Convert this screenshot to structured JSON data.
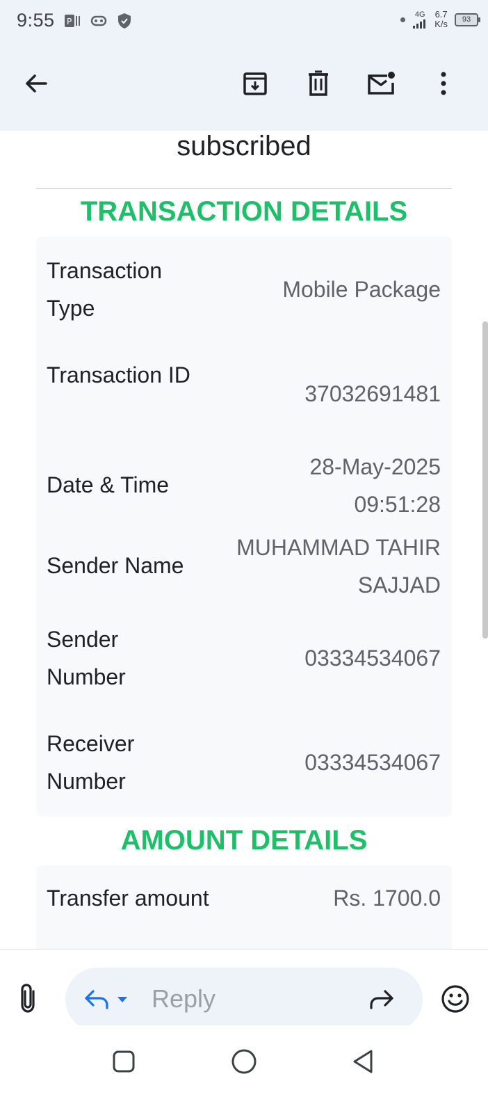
{
  "status": {
    "time": "9:55",
    "network": "4G",
    "speed_top": "6.7",
    "speed_bottom": "K/s",
    "battery": "93"
  },
  "toolbar": {
    "icons": [
      "back-arrow-icon",
      "archive-icon",
      "delete-icon",
      "mark-unread-icon",
      "more-vert-icon"
    ]
  },
  "email": {
    "intro_text": "subscribed",
    "transaction_title": "TRANSACTION DETAILS",
    "transaction_rows": [
      {
        "label": "Transaction Type",
        "value": "Mobile Package"
      },
      {
        "label": "Transaction ID",
        "value": "37032691481"
      },
      {
        "label": "Date & Time",
        "value": "28-May-2025 09:51:28"
      },
      {
        "label": "Sender Name",
        "value": "MUHAMMAD TAHIR SAJJAD"
      },
      {
        "label": "Sender Number",
        "value": "03334534067"
      },
      {
        "label": "Receiver Number",
        "value": "03334534067"
      }
    ],
    "amount_title": "AMOUNT DETAILS",
    "amount_rows": [
      {
        "label": "Transfer amount",
        "value": "Rs. 1700.0"
      }
    ]
  },
  "reply_bar": {
    "placeholder": "Reply"
  },
  "colors": {
    "accent_green": "#1fbf6a",
    "toolbar_bg": "#eef2f9",
    "card_bg": "#f8f9fa"
  }
}
